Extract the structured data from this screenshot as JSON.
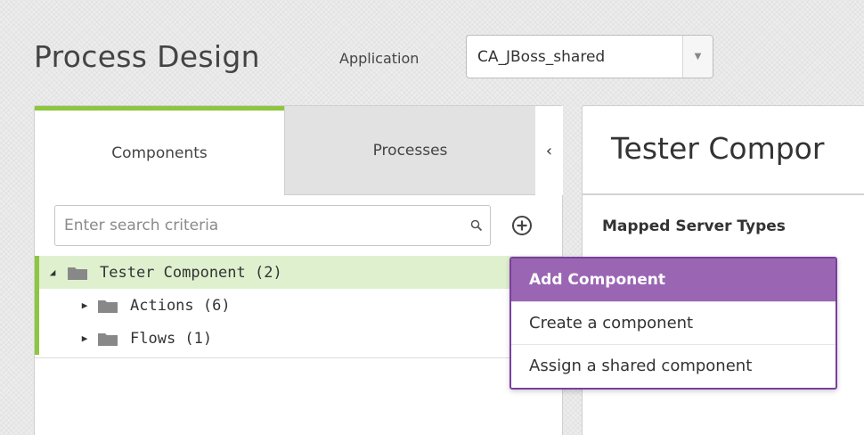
{
  "header": {
    "title": "Process Design",
    "application_label": "Application",
    "application_value": "CA_JBoss_shared"
  },
  "left_panel": {
    "tabs": [
      {
        "label": "Components",
        "active": true
      },
      {
        "label": "Processes",
        "active": false
      }
    ],
    "collapse_glyph": "‹",
    "search": {
      "placeholder": "Enter search criteria",
      "value": ""
    },
    "tree": [
      {
        "label": "Tester Component (2)",
        "expanded": true,
        "selected": true
      },
      {
        "label": "Actions (6)",
        "expanded": false
      },
      {
        "label": "Flows (1)",
        "expanded": false
      }
    ]
  },
  "right_panel": {
    "title": "Tester Compor",
    "section_label": "Mapped Server Types"
  },
  "dropdown": {
    "header": "Add Component",
    "items": [
      "Create a component",
      "Assign a shared component"
    ]
  },
  "colors": {
    "accent_green": "#8dc63f",
    "selected_row": "#dff0cf",
    "menu_purple": "#9a66b3",
    "menu_border": "#7b3fa0"
  },
  "icons": [
    "search-icon",
    "add-circle-icon",
    "folder-icon",
    "caret-down-icon",
    "caret-right-icon",
    "chevron-left-icon"
  ]
}
